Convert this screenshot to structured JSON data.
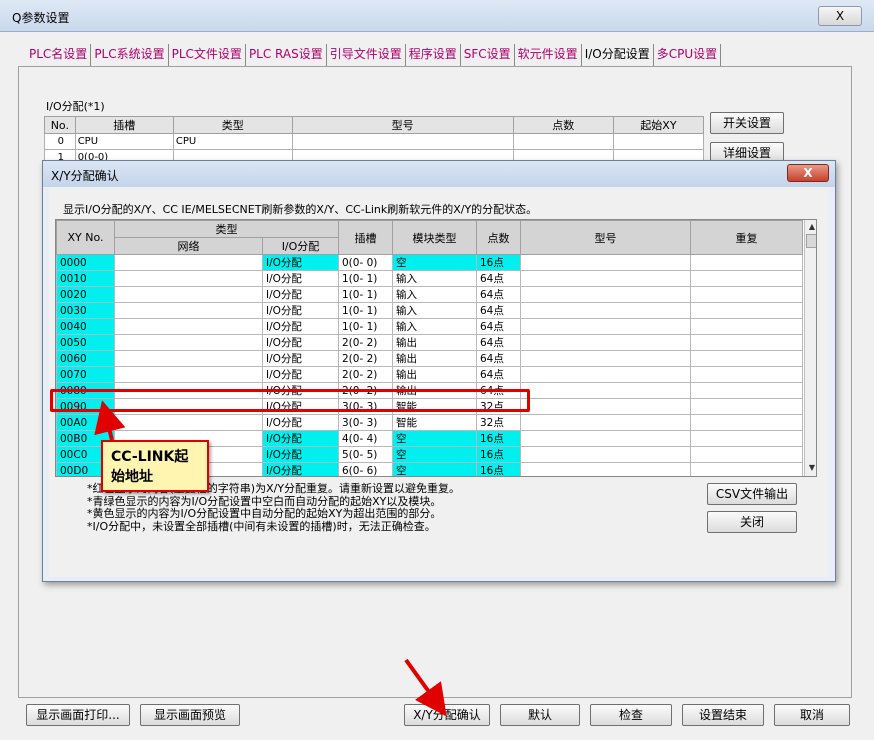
{
  "window": {
    "title": "Q参数设置",
    "close_label": "X"
  },
  "tabs": [
    "PLC名设置",
    "PLC系统设置",
    "PLC文件设置",
    "PLC RAS设置",
    "引导文件设置",
    "程序设置",
    "SFC设置",
    "软元件设置",
    "I/O分配设置",
    "多CPU设置"
  ],
  "active_tab": "I/O分配设置",
  "io_assign": {
    "group_label": "I/O分配(*1)",
    "headers": [
      "No.",
      "插槽",
      "类型",
      "型号",
      "点数",
      "起始XY"
    ],
    "rows": [
      {
        "no": "0",
        "slot": "CPU",
        "type": "CPU",
        "model": "",
        "points": "",
        "start": ""
      },
      {
        "no": "1",
        "slot": "0(0-0)",
        "type": "",
        "model": "",
        "points": "",
        "start": ""
      }
    ],
    "switch_setting": "开关设置",
    "detail_setting": "详细设置"
  },
  "dialog": {
    "title": "X/Y分配确认",
    "close_label": "X",
    "description": "显示I/O分配的X/Y、CC IE/MELSECNET刷新参数的X/Y、CC-Link刷新软元件的X/Y的分配状态。",
    "headers": {
      "xy_no": "XY No.",
      "type": "类型",
      "network": "网络",
      "io_assign": "I/O分配",
      "slot": "插槽",
      "module_type": "模块类型",
      "points": "点数",
      "model": "型号",
      "duplicate": "重复"
    },
    "rows": [
      {
        "xy": "0000",
        "network": "",
        "io": "I/O分配",
        "slot": "0(0- 0)",
        "module": "空",
        "points": "16点",
        "model": "",
        "dup": "",
        "cyan": [
          "xy",
          "io",
          "module",
          "points"
        ]
      },
      {
        "xy": "0010",
        "network": "",
        "io": "I/O分配",
        "slot": "1(0- 1)",
        "module": "输入",
        "points": "64点",
        "model": "",
        "dup": "",
        "cyan": [
          "xy"
        ]
      },
      {
        "xy": "0020",
        "network": "",
        "io": "I/O分配",
        "slot": "1(0- 1)",
        "module": "输入",
        "points": "64点",
        "model": "",
        "dup": "",
        "cyan": [
          "xy"
        ]
      },
      {
        "xy": "0030",
        "network": "",
        "io": "I/O分配",
        "slot": "1(0- 1)",
        "module": "输入",
        "points": "64点",
        "model": "",
        "dup": "",
        "cyan": [
          "xy"
        ]
      },
      {
        "xy": "0040",
        "network": "",
        "io": "I/O分配",
        "slot": "1(0- 1)",
        "module": "输入",
        "points": "64点",
        "model": "",
        "dup": "",
        "cyan": [
          "xy"
        ]
      },
      {
        "xy": "0050",
        "network": "",
        "io": "I/O分配",
        "slot": "2(0- 2)",
        "module": "输出",
        "points": "64点",
        "model": "",
        "dup": "",
        "cyan": [
          "xy"
        ]
      },
      {
        "xy": "0060",
        "network": "",
        "io": "I/O分配",
        "slot": "2(0- 2)",
        "module": "输出",
        "points": "64点",
        "model": "",
        "dup": "",
        "cyan": [
          "xy"
        ]
      },
      {
        "xy": "0070",
        "network": "",
        "io": "I/O分配",
        "slot": "2(0- 2)",
        "module": "输出",
        "points": "64点",
        "model": "",
        "dup": "",
        "cyan": [
          "xy"
        ]
      },
      {
        "xy": "0080",
        "network": "",
        "io": "I/O分配",
        "slot": "2(0- 2)",
        "module": "输出",
        "points": "64点",
        "model": "",
        "dup": "",
        "cyan": [
          "xy"
        ]
      },
      {
        "xy": "0090",
        "network": "",
        "io": "I/O分配",
        "slot": "3(0- 3)",
        "module": "智能",
        "points": "32点",
        "model": "",
        "dup": "",
        "cyan": [
          "xy"
        ]
      },
      {
        "xy": "00A0",
        "network": "",
        "io": "I/O分配",
        "slot": "3(0- 3)",
        "module": "智能",
        "points": "32点",
        "model": "",
        "dup": "",
        "cyan": [
          "xy"
        ]
      },
      {
        "xy": "00B0",
        "network": "",
        "io": "I/O分配",
        "slot": "4(0- 4)",
        "module": "空",
        "points": "16点",
        "model": "",
        "dup": "",
        "cyan": [
          "xy",
          "io",
          "module",
          "points"
        ]
      },
      {
        "xy": "00C0",
        "network": "",
        "io": "I/O分配",
        "slot": "5(0- 5)",
        "module": "空",
        "points": "16点",
        "model": "",
        "dup": "",
        "cyan": [
          "xy",
          "io",
          "module",
          "points"
        ]
      },
      {
        "xy": "00D0",
        "network": "",
        "io": "I/O分配",
        "slot": "6(0- 6)",
        "module": "空",
        "points": "16点",
        "model": "",
        "dup": "",
        "cyan": [
          "xy",
          "io",
          "module",
          "points"
        ]
      }
    ],
    "notes": [
      "*红色显示的内容(重复栏的字符串)为X/Y分配重复。请重新设置以避免重复。",
      "*青绿色显示的内容为I/O分配设置中空白而自动分配的起始XY以及模块。",
      "*黄色显示的内容为I/O分配设置中自动分配的起始XY为超出范围的部分。",
      "*I/O分配中，未设置全部插槽(中间有未设置的插槽)时，无法正确检查。"
    ],
    "csv_button": "CSV文件输出",
    "close_button": "关闭"
  },
  "annotation": {
    "callout_text": "CC-LINK起始地址",
    "highlight_row": "0090"
  },
  "bottom_buttons": {
    "print": "显示画面打印...",
    "preview": "显示画面预览",
    "xy_confirm": "X/Y分配确认",
    "default": "默认",
    "check": "检查",
    "finish": "设置结束",
    "cancel": "取消"
  },
  "colors": {
    "cyan": "#00f0f0",
    "highlight": "#e00000",
    "callout_bg": "#fff5b0",
    "tab_text": "#b0006b"
  }
}
